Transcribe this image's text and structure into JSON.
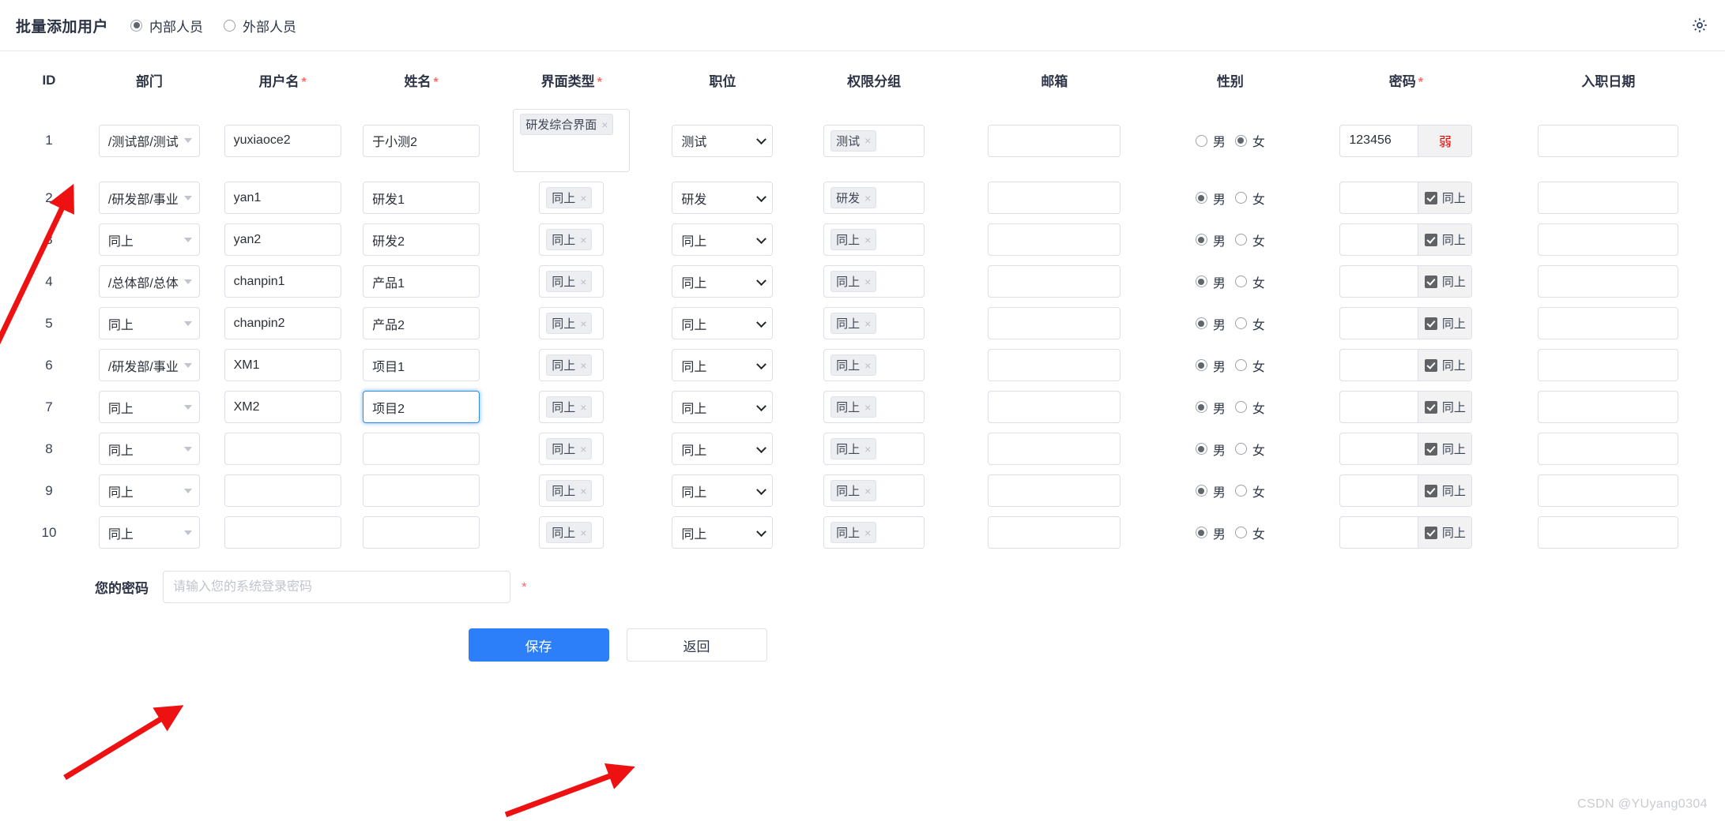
{
  "header": {
    "title": "批量添加用户",
    "person_type_options": [
      {
        "label": "内部人员",
        "checked": true
      },
      {
        "label": "外部人员",
        "checked": false
      }
    ],
    "settings_icon": "gear-icon"
  },
  "columns": [
    {
      "key": "id",
      "label": "ID",
      "required": false
    },
    {
      "key": "dept",
      "label": "部门",
      "required": false
    },
    {
      "key": "username",
      "label": "用户名",
      "required": true
    },
    {
      "key": "fullname",
      "label": "姓名",
      "required": true
    },
    {
      "key": "ui_type",
      "label": "界面类型",
      "required": true
    },
    {
      "key": "position",
      "label": "职位",
      "required": false
    },
    {
      "key": "perm_group",
      "label": "权限分组",
      "required": false
    },
    {
      "key": "email",
      "label": "邮箱",
      "required": false
    },
    {
      "key": "gender",
      "label": "性别",
      "required": false
    },
    {
      "key": "password",
      "label": "密码",
      "required": true
    },
    {
      "key": "hire_date",
      "label": "入职日期",
      "required": false
    }
  ],
  "same_as_above_label": "同上",
  "gender_labels": {
    "male": "男",
    "female": "女"
  },
  "rows": [
    {
      "id": "1",
      "dept": "/测试部/测试",
      "username": "yuxiaoce2",
      "fullname": "于小测",
      "fullname_full": "于小测2",
      "ui_type_tags": [
        "研发综合界面"
      ],
      "ui_type_tall": true,
      "position": "测试",
      "perm_group_tags": [
        "测试"
      ],
      "email": "",
      "gender": "female",
      "password_value": "123456",
      "password_suffix": "弱",
      "password_same": false,
      "hire_date": ""
    },
    {
      "id": "2",
      "dept": "/研发部/事业",
      "username": "yan1",
      "fullname": "研发1",
      "ui_type_tags": [
        "同上"
      ],
      "ui_type_tall": false,
      "position": "研发",
      "perm_group_tags": [
        "研发"
      ],
      "email": "",
      "gender": "male",
      "password_value": "",
      "password_suffix": "同上",
      "password_same": true,
      "hire_date": ""
    },
    {
      "id": "3",
      "dept": "同上",
      "username": "yan2",
      "fullname": "研发2",
      "ui_type_tags": [
        "同上"
      ],
      "ui_type_tall": false,
      "position": "同上",
      "perm_group_tags": [
        "同上"
      ],
      "email": "",
      "gender": "male",
      "password_value": "",
      "password_suffix": "同上",
      "password_same": true,
      "hire_date": ""
    },
    {
      "id": "4",
      "dept": "/总体部/总体",
      "username": "chanpin1",
      "fullname": "产品1",
      "ui_type_tags": [
        "同上"
      ],
      "ui_type_tall": false,
      "position": "同上",
      "perm_group_tags": [
        "同上"
      ],
      "email": "",
      "gender": "male",
      "password_value": "",
      "password_suffix": "同上",
      "password_same": true,
      "hire_date": ""
    },
    {
      "id": "5",
      "dept": "同上",
      "username": "chanpin2",
      "fullname": "产品2",
      "ui_type_tags": [
        "同上"
      ],
      "ui_type_tall": false,
      "position": "同上",
      "perm_group_tags": [
        "同上"
      ],
      "email": "",
      "gender": "male",
      "password_value": "",
      "password_suffix": "同上",
      "password_same": true,
      "hire_date": ""
    },
    {
      "id": "6",
      "dept": "/研发部/事业",
      "username": "XM1",
      "fullname": "项目1",
      "ui_type_tags": [
        "同上"
      ],
      "ui_type_tall": false,
      "position": "同上",
      "perm_group_tags": [
        "同上"
      ],
      "email": "",
      "gender": "male",
      "password_value": "",
      "password_suffix": "同上",
      "password_same": true,
      "hire_date": ""
    },
    {
      "id": "7",
      "dept": "同上",
      "username": "XM2",
      "fullname": "项目2",
      "fullname_focused": true,
      "ui_type_tags": [
        "同上"
      ],
      "ui_type_tall": false,
      "position": "同上",
      "perm_group_tags": [
        "同上"
      ],
      "email": "",
      "gender": "male",
      "password_value": "",
      "password_suffix": "同上",
      "password_same": true,
      "hire_date": ""
    },
    {
      "id": "8",
      "dept": "同上",
      "username": "",
      "fullname": "",
      "ui_type_tags": [
        "同上"
      ],
      "ui_type_tall": false,
      "position": "同上",
      "perm_group_tags": [
        "同上"
      ],
      "email": "",
      "gender": "male",
      "password_value": "",
      "password_suffix": "同上",
      "password_same": true,
      "hire_date": ""
    },
    {
      "id": "9",
      "dept": "同上",
      "username": "",
      "fullname": "",
      "ui_type_tags": [
        "同上"
      ],
      "ui_type_tall": false,
      "position": "同上",
      "perm_group_tags": [
        "同上"
      ],
      "email": "",
      "gender": "male",
      "password_value": "",
      "password_suffix": "同上",
      "password_same": true,
      "hire_date": ""
    },
    {
      "id": "10",
      "dept": "同上",
      "username": "",
      "fullname": "",
      "ui_type_tags": [
        "同上"
      ],
      "ui_type_tall": false,
      "position": "同上",
      "perm_group_tags": [
        "同上"
      ],
      "email": "",
      "gender": "male",
      "password_value": "",
      "password_suffix": "同上",
      "password_same": true,
      "hire_date": ""
    }
  ],
  "footer": {
    "own_password_label": "您的密码",
    "own_password_value": "",
    "own_password_placeholder": "请输入您的系统登录密码",
    "own_password_required": "*",
    "save_label": "保存",
    "back_label": "返回"
  },
  "watermark": "CSDN @YUyang0304",
  "colors": {
    "primary": "#2d7ff9",
    "required_star": "#ff6b6b",
    "weak_password": "#ee0000",
    "annotation_arrow": "#ee1111",
    "focus_ring": "#2d8cf0"
  }
}
